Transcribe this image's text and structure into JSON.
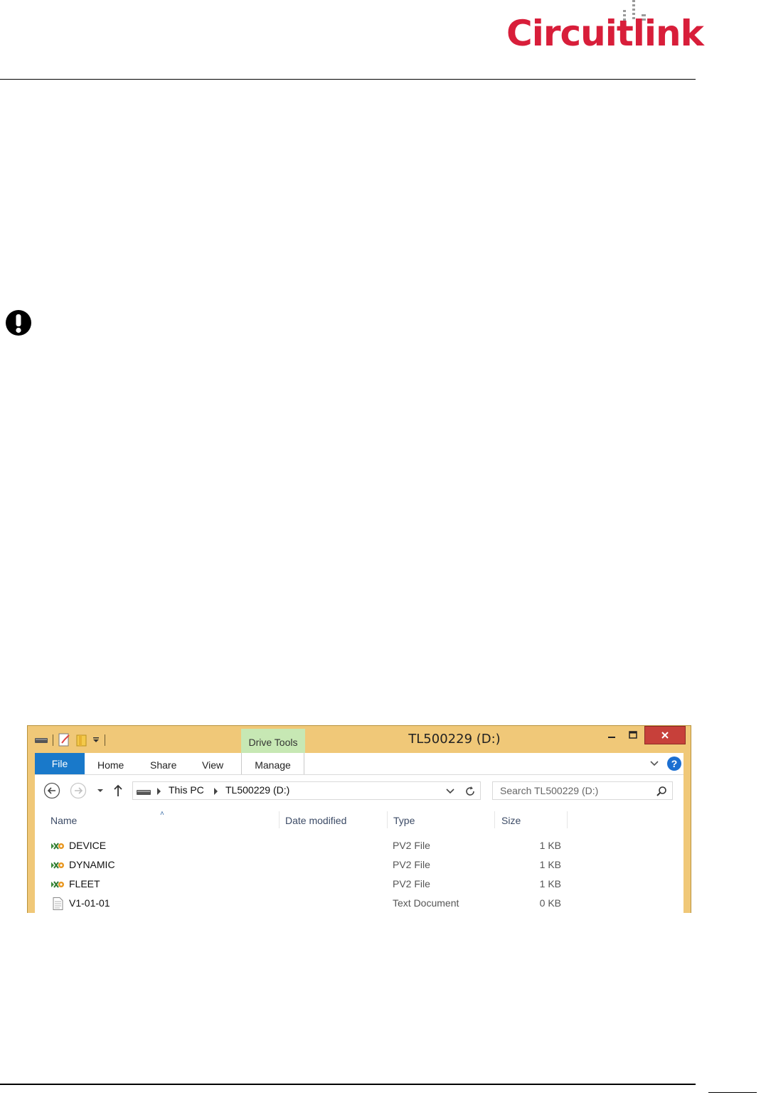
{
  "logo": {
    "text": "Circuitlink"
  },
  "icons": {
    "warning": "exclamation-circle-icon",
    "qat_drive": "drive-icon",
    "qat_properties": "properties-icon",
    "qat_new_folder": "new-folder-icon",
    "pv2": "pv2-file-icon",
    "text": "text-document-icon"
  },
  "colors": {
    "brand_red": "#d81e3a",
    "window_frame": "#f0c878",
    "file_tab": "#1979ca",
    "drive_tools_tab": "#c7e8b4",
    "close_button": "#c7403a"
  },
  "window": {
    "title": "TL500229 (D:)",
    "contextual_tab": "Drive Tools",
    "tabs": {
      "file": "File",
      "home": "Home",
      "share": "Share",
      "view": "View",
      "manage": "Manage"
    },
    "address": {
      "segments": [
        "This PC",
        "TL500229 (D:)"
      ]
    },
    "search": {
      "placeholder": "Search TL500229 (D:)"
    },
    "columns": {
      "name": "Name",
      "date_modified": "Date modified",
      "type": "Type",
      "size": "Size"
    },
    "files": [
      {
        "name": "DEVICE",
        "date_modified": "",
        "type": "PV2 File",
        "size": "1 KB",
        "icon": "pv2-file-icon"
      },
      {
        "name": "DYNAMIC",
        "date_modified": "",
        "type": "PV2 File",
        "size": "1 KB",
        "icon": "pv2-file-icon"
      },
      {
        "name": "FLEET",
        "date_modified": "",
        "type": "PV2 File",
        "size": "1 KB",
        "icon": "pv2-file-icon"
      },
      {
        "name": "V1-01-01",
        "date_modified": "",
        "type": "Text Document",
        "size": "0 KB",
        "icon": "text-document-icon"
      }
    ]
  }
}
